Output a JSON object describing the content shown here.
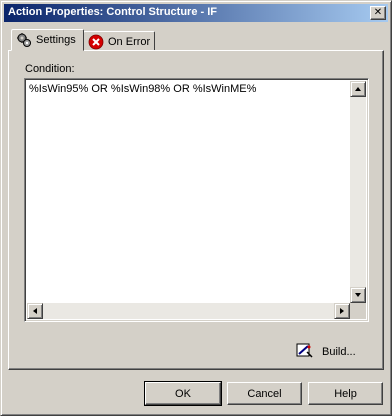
{
  "window": {
    "title": "Action Properties: Control Structure - IF",
    "close_glyph": "✕"
  },
  "tabs": [
    {
      "label": "Settings",
      "icon": "gear-icon",
      "active": true
    },
    {
      "label": "On Error",
      "icon": "error-x-icon",
      "active": false
    }
  ],
  "settings": {
    "condition_label": "Condition:",
    "condition_value": "%IsWin95% OR %IsWin98% OR %IsWinME%"
  },
  "build": {
    "label": "Build...",
    "icon": "build-wand-icon"
  },
  "buttons": {
    "ok": "OK",
    "cancel": "Cancel",
    "help": "Help"
  },
  "colors": {
    "title_start": "#0a246a",
    "title_end": "#a6caf0",
    "face": "#d4d0c8",
    "error_red": "#d40000"
  }
}
